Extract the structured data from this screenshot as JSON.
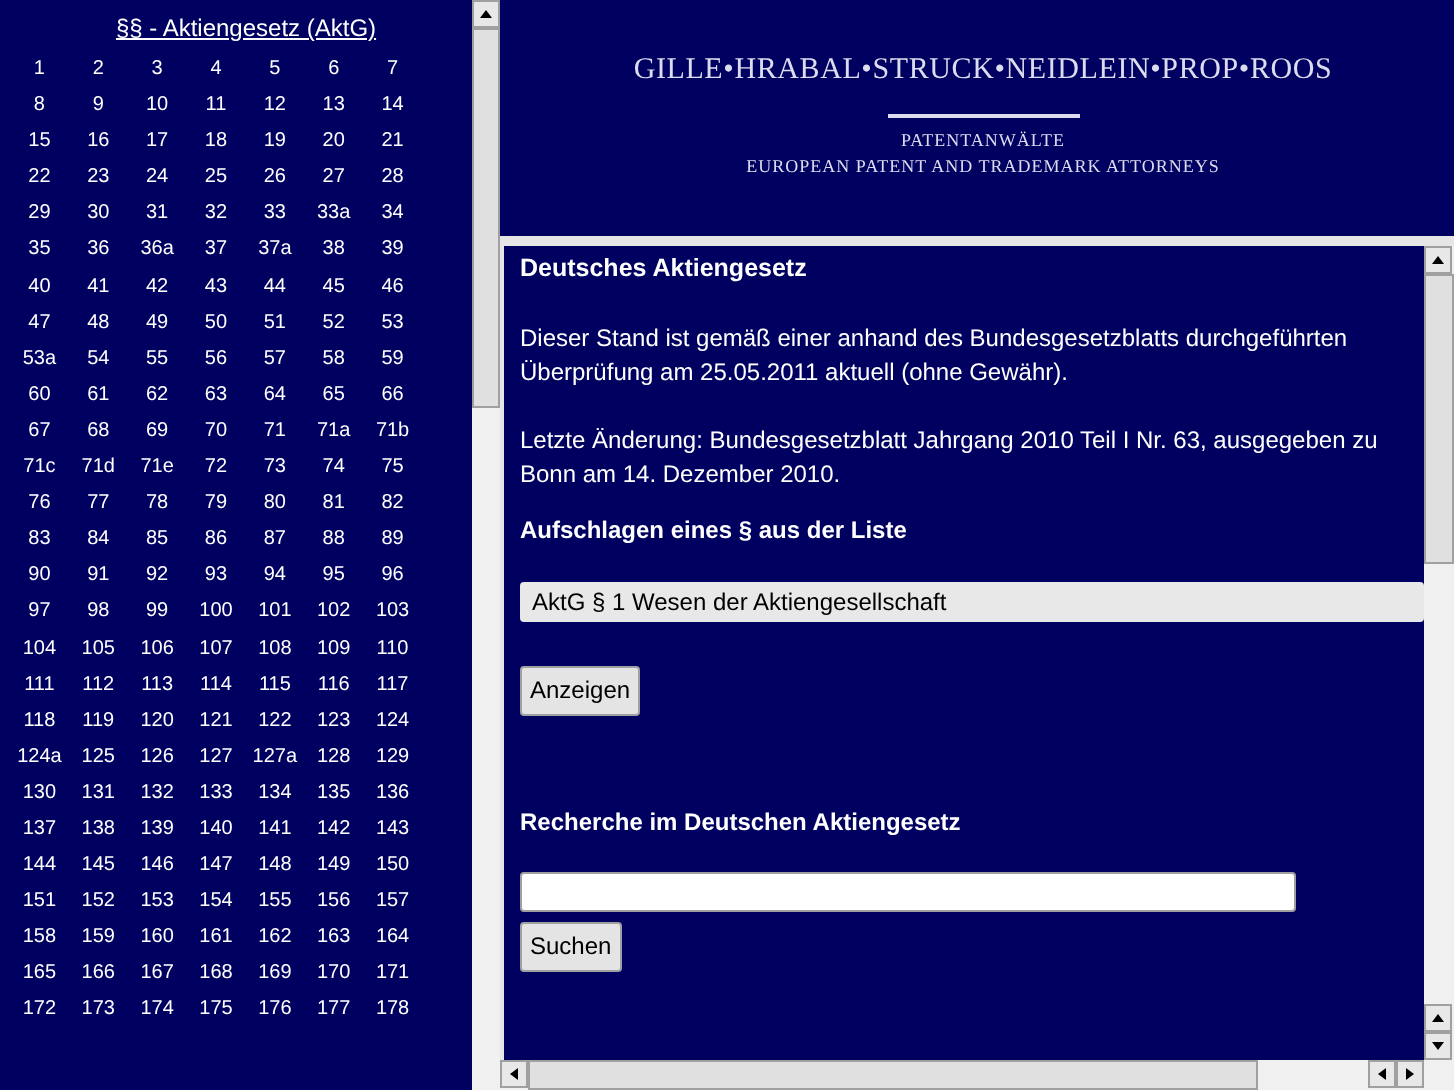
{
  "index": {
    "title": "§§ - Aktiengesetz (AktG)",
    "sections": [
      "1",
      "2",
      "3",
      "4",
      "5",
      "6",
      "7",
      "8",
      "9",
      "10",
      "11",
      "12",
      "13",
      "14",
      "15",
      "16",
      "17",
      "18",
      "19",
      "20",
      "21",
      "22",
      "23",
      "24",
      "25",
      "26",
      "27",
      "28",
      "29",
      "30",
      "31",
      "32",
      "33",
      "33a",
      "34",
      "35",
      "36",
      "36a",
      "37",
      "37a",
      "38",
      "39",
      "40",
      "41",
      "42",
      "43",
      "44",
      "45",
      "46",
      "47",
      "48",
      "49",
      "50",
      "51",
      "52",
      "53",
      "53a",
      "54",
      "55",
      "56",
      "57",
      "58",
      "59",
      "60",
      "61",
      "62",
      "63",
      "64",
      "65",
      "66",
      "67",
      "68",
      "69",
      "70",
      "71",
      "71a",
      "71b",
      "71c",
      "71d",
      "71e",
      "72",
      "73",
      "74",
      "75",
      "76",
      "77",
      "78",
      "79",
      "80",
      "81",
      "82",
      "83",
      "84",
      "85",
      "86",
      "87",
      "88",
      "89",
      "90",
      "91",
      "92",
      "93",
      "94",
      "95",
      "96",
      "97",
      "98",
      "99",
      "100",
      "101",
      "102",
      "103",
      "104",
      "105",
      "106",
      "107",
      "108",
      "109",
      "110",
      "111",
      "112",
      "113",
      "114",
      "115",
      "116",
      "117",
      "118",
      "119",
      "120",
      "121",
      "122",
      "123",
      "124",
      "124a",
      "125",
      "126",
      "127",
      "127a",
      "128",
      "129",
      "130",
      "131",
      "132",
      "133",
      "134",
      "135",
      "136",
      "137",
      "138",
      "139",
      "140",
      "141",
      "142",
      "143",
      "144",
      "145",
      "146",
      "147",
      "148",
      "149",
      "150",
      "151",
      "152",
      "153",
      "154",
      "155",
      "156",
      "157",
      "158",
      "159",
      "160",
      "161",
      "162",
      "163",
      "164",
      "165",
      "166",
      "167",
      "168",
      "169",
      "170",
      "171",
      "172",
      "173",
      "174",
      "175",
      "176",
      "177",
      "178"
    ]
  },
  "header": {
    "firm": "GILLE•HRABAL•STRUCK•NEIDLEIN•PROP•ROOS",
    "line1": "PATENTANWÄLTE",
    "line2": "EUROPEAN PATENT AND TRADEMARK ATTORNEYS"
  },
  "content": {
    "title": "Deutsches Aktiengesetz",
    "paragraphs": [
      "Dieser Stand ist gemäß einer anhand des Bundesgesetzblatts durchgeführten Überprüfung am 25.05.2011 aktuell (ohne Gewähr).",
      "Letzte Änderung: Bundesgesetzblatt Jahrgang 2010 Teil I Nr. 63, ausgegeben zu Bonn am 14. Dezember 2010."
    ],
    "select_heading": "Aufschlagen eines § aus der Liste",
    "select_value": "AktG § 1 Wesen der Aktiengesellschaft",
    "show_button": "Anzeigen",
    "search_heading": "Recherche im Deutschen Aktiengesetz",
    "search_button": "Suchen"
  }
}
